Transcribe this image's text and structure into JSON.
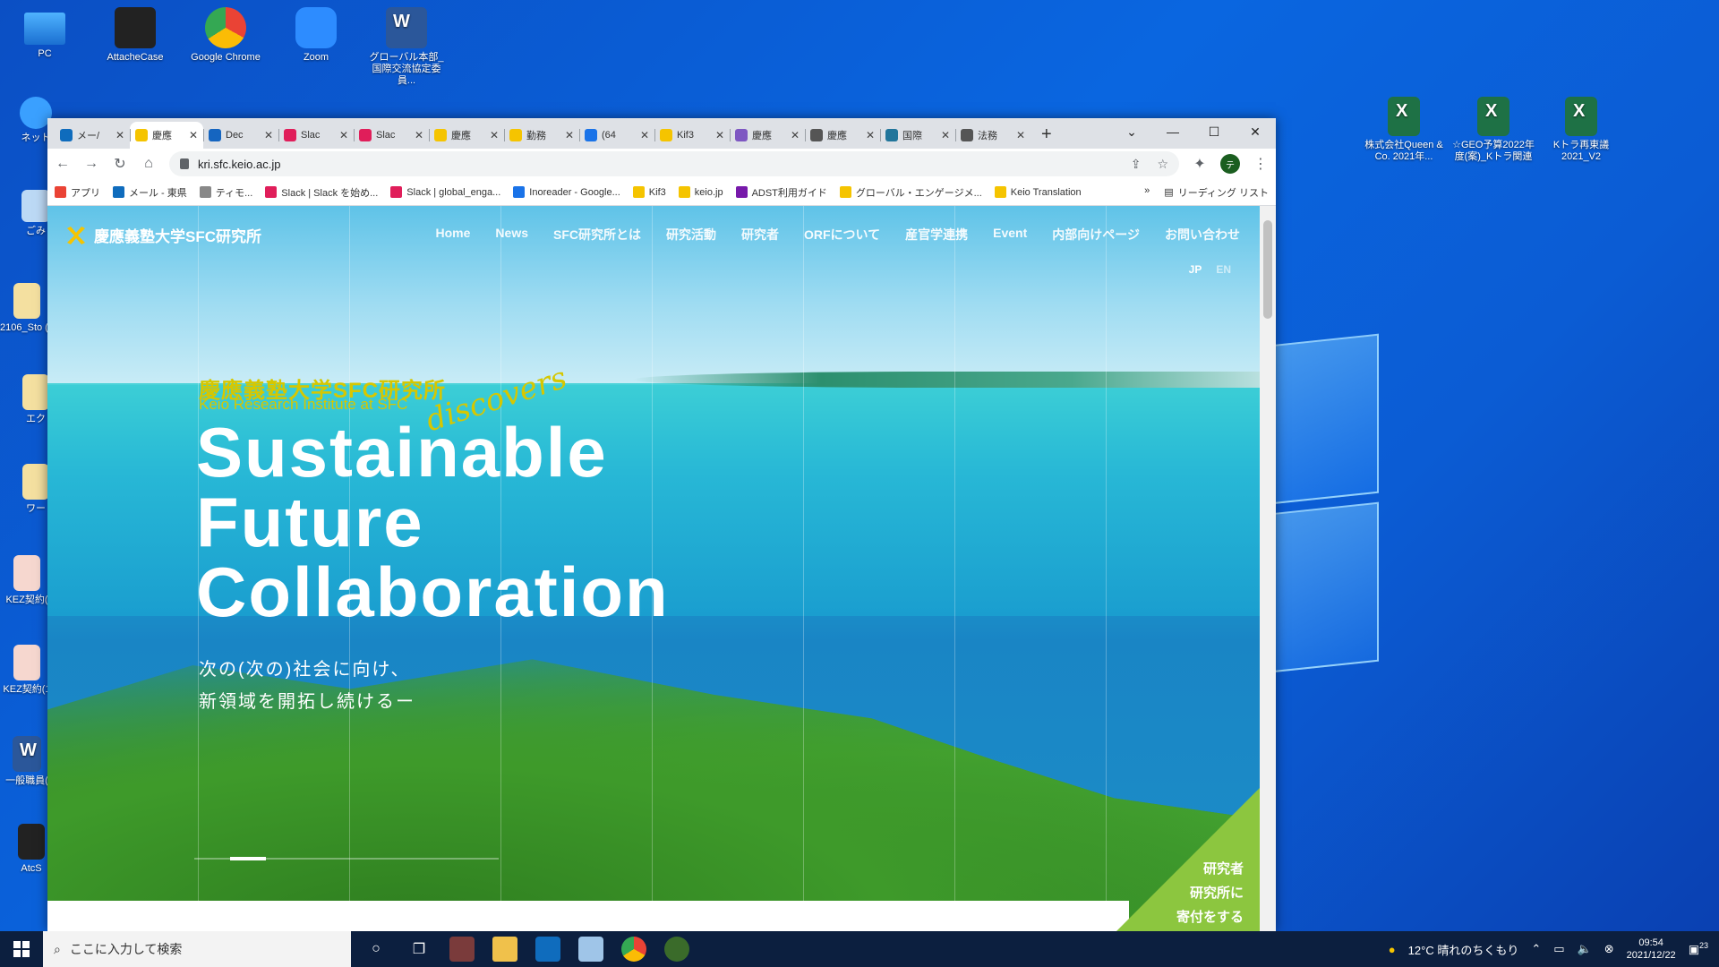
{
  "desktop": {
    "icons_left": [
      {
        "label": "PC"
      },
      {
        "label": "AttacheCase"
      },
      {
        "label": "Google Chrome"
      },
      {
        "label": "Zoom"
      },
      {
        "label": "グローバル本部_国際交流協定委員..."
      }
    ],
    "side_labels": [
      "ネット",
      "ごみ",
      "2106_Sto (2",
      "エク",
      "ワー",
      "KEZ契約(",
      "KEZ契約(1",
      "一般職員(",
      "AtcS"
    ],
    "icons_right": [
      {
        "label": "株式会社Queen & Co. 2021年..."
      },
      {
        "label": "☆GEO予算2022年度(案)_Kトラ関連"
      },
      {
        "label": "Kトラ再東議2021_V2"
      }
    ]
  },
  "browser": {
    "tabs": [
      {
        "label": "メー/",
        "color": "#0f6cbd"
      },
      {
        "label": "慶應",
        "color": "#f5c400",
        "active": true
      },
      {
        "label": "Dec",
        "color": "#1565c0"
      },
      {
        "label": "Slac",
        "color": "#e01e5a"
      },
      {
        "label": "Slac",
        "color": "#e01e5a"
      },
      {
        "label": "慶應",
        "color": "#f5c400"
      },
      {
        "label": "勤務",
        "color": "#f5c400"
      },
      {
        "label": "(64",
        "color": "#1a73e8"
      },
      {
        "label": "Kif3",
        "color": "#f5c400"
      },
      {
        "label": "慶應",
        "color": "#7e57c2"
      },
      {
        "label": "慶應",
        "color": "#555555"
      },
      {
        "label": "国際",
        "color": "#21759b"
      },
      {
        "label": "法務",
        "color": "#555555"
      }
    ],
    "url": "kri.sfc.keio.ac.jp",
    "bookmarks": [
      {
        "label": "アプリ",
        "color": "#ea4335"
      },
      {
        "label": "メール - 東県",
        "color": "#0f6cbd"
      },
      {
        "label": "ティモ...",
        "color": "#888888"
      },
      {
        "label": "Slack | Slack を始め...",
        "color": "#e01e5a"
      },
      {
        "label": "Slack | global_enga...",
        "color": "#e01e5a"
      },
      {
        "label": "Inoreader - Google...",
        "color": "#1a73e8"
      },
      {
        "label": "Kif3",
        "color": "#f5c400"
      },
      {
        "label": "keio.jp",
        "color": "#f5c400"
      },
      {
        "label": "ADST利用ガイド",
        "color": "#7719aa"
      },
      {
        "label": "グローバル・エンゲージメ...",
        "color": "#f5c400"
      },
      {
        "label": "Keio Translation",
        "color": "#f5c400"
      }
    ],
    "bookmarks_more": "»",
    "reading_list": "リーディング リスト",
    "profile_initial": "テ"
  },
  "site": {
    "logo_text": "慶應義塾大学SFC研究所",
    "nav": [
      "Home",
      "News",
      "SFC研究所とは",
      "研究活動",
      "研究者",
      "ORFについて",
      "産官学連携",
      "Event",
      "内部向けページ",
      "お問い合わせ"
    ],
    "lang_jp": "JP",
    "lang_en": "EN",
    "kicker_jp": "慶應義塾大学SFC研究所",
    "kicker_en": "Keio Research Institute at SFC",
    "script_word": "discovers",
    "headline": [
      "Sustainable",
      "Future",
      "Collaboration"
    ],
    "sub": [
      "次の(次の)社会に向け、",
      "新領域を開拓し続けるー"
    ],
    "donate": [
      "研究者",
      "研究所に",
      "寄付をする"
    ],
    "accent_yellow": "#d6c700",
    "accent_green": "#8cc63f"
  },
  "taskbar": {
    "search_placeholder": "ここに入力して検索",
    "weather": "12°C  晴れのちくもり",
    "time": "09:54",
    "date": "2021/12/22",
    "notifications": "23"
  }
}
